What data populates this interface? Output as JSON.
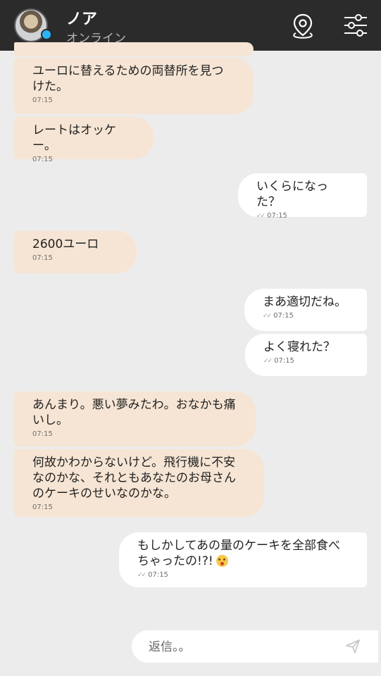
{
  "header": {
    "name": "ノア",
    "status": "オンライン",
    "map_icon": "map-pin-icon",
    "filter_icon": "sliders-icon"
  },
  "messages": [
    {
      "direction": "received",
      "text": "ユーロに替えるための両替所を見つ\nけた。",
      "time": "07:15"
    },
    {
      "direction": "received",
      "text": "レートはオッケー。",
      "time": "07:15"
    },
    {
      "direction": "sent",
      "text": "いくらになった？",
      "time": "07:15"
    },
    {
      "direction": "received",
      "text": "2600ユーロ",
      "time": "07:15"
    },
    {
      "direction": "sent",
      "text": "まあ適切だね。",
      "time": "07:15"
    },
    {
      "direction": "sent",
      "text": "よく寝れた？",
      "time": "07:15"
    },
    {
      "direction": "received",
      "text": "あんまり。悪い夢みたわ。おなかも痛\nいし。",
      "time": "07:15"
    },
    {
      "direction": "received",
      "text": "何故かわからないけど。飛行機に不安\nなのかな、それともあなたのお母さん\nのケーキのせいなのかな。",
      "time": "07:15"
    },
    {
      "direction": "sent",
      "text": "もしかしてあの量のケーキを全部食べ\nちゃったの!?!",
      "time": "07:15",
      "emoji": "astonished-face-emoji"
    }
  ],
  "composer": {
    "placeholder": "返信。。",
    "send_icon": "send-icon"
  },
  "colors": {
    "header_bg": "#2b2b2b",
    "received_bubble": "#f6e5d4",
    "sent_bubble": "#ffffff",
    "background": "#ececec",
    "online_dot": "#29b6f6"
  }
}
